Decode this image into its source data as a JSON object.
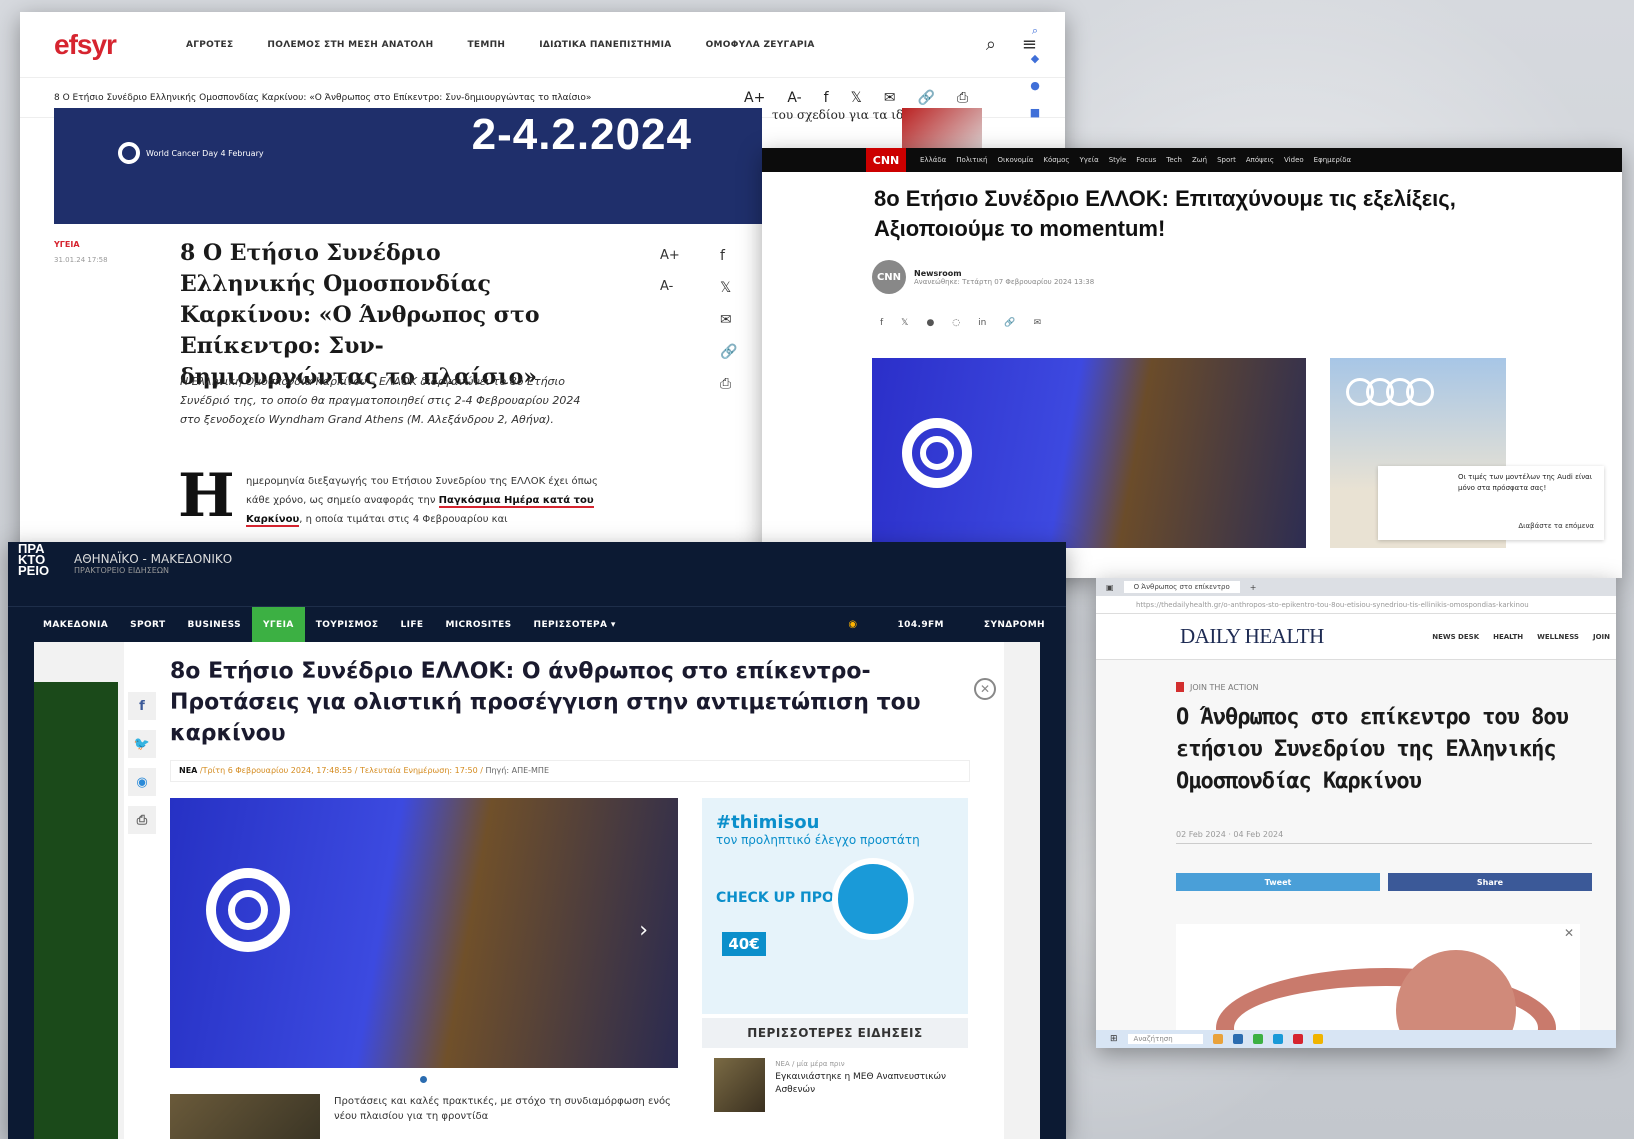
{
  "efsyr": {
    "logo": "efsyr",
    "nav": [
      "ΑΓΡΟΤΕΣ",
      "ΠΟΛΕΜΟΣ ΣΤΗ ΜΕΣΗ ΑΝΑΤΟΛΗ",
      "ΤΕΜΠΗ",
      "ΙΔΙΩΤΙΚΑ ΠΑΝΕΠΙΣΤΗΜΙΑ",
      "ΟΜΟΦΥΛΑ ΖΕΥΓΑΡΙΑ"
    ],
    "breadcrumb": "8 Ο Ετήσιο Συνέδριο Ελληνικής Ομοσπονδίας Καρκίνου: «Ο Άνθρωπος στο Επίκεντρο: Συν-δημιουργώντας το πλαίσιο»",
    "font_up": "A+",
    "font_down": "A-",
    "banner_date": "2-4.2.2024",
    "banner_badge": "World Cancer Day 4 February",
    "category": "ΥΓΕΙΑ",
    "category_date": "31.01.24 17:58",
    "title": "8 Ο Ετήσιο Συνέδριο Ελληνικής Ομοσπονδίας Καρκίνου: «Ο Άνθρωπος στο Επίκεντρο: Συν-δημιουργώντας το πλαίσιο»",
    "lead": "Η Ελληνική Ομοσπονδία Καρκίνου – ΕΛΛΟΚ διοργανώνει το 8ο Ετήσιο Συνέδριό της, το οποίο θα πραγματοποιηθεί στις 2-4 Φεβρουαρίου 2024 στο ξενοδοχείο Wyndham Grand Athens (Μ. Αλεξάνδρου 2, Αθήνα).",
    "drop_cap": "Η",
    "body_pre": "ημερομηνία διεξαγωγής του Ετήσιου Συνεδρίου της ΕΛΛΟΚ έχει όπως κάθε χρόνο, ως σημείο αναφοράς την ",
    "body_link": "Παγκόσμια Ημέρα κατά του Καρκίνου",
    "body_post": ", η οποία τιμάται στις 4 Φεβρουαρίου και",
    "sidebar_teaser": "του σχεδίου για τα ιδιωτικά ΑΕΙ"
  },
  "cnn": {
    "logo": "CNN",
    "nav": [
      "Ελλάδα",
      "Πολιτική",
      "Οικονομία",
      "Κόσμος",
      "Υγεία",
      "Style",
      "Focus",
      "Tech",
      "Ζωή",
      "Sport",
      "Απόψεις",
      "Video",
      "Εφημερίδα"
    ],
    "title": "8o Ετήσιο Συνέδριο ΕΛΛΟΚ: Επιταχύνουμε τις εξελίξεις, Αξιοποιούμε το momentum!",
    "avatar": "CNN",
    "author": "Newsroom",
    "date": "Ανανεώθηκε: Τετάρτη 07 Φεβρουαρίου 2024 13:38",
    "ad_text": "Οι τιμές των μοντέλων της Audi είναι μόνο στα πρόσφατα σας!",
    "ad_cta": "Διαβάστε τα επόμενα"
  },
  "apeb": {
    "brand": "ΠΡΑ ΚΤΟ ΡΕΙΟ",
    "brand_name": "ΑΘΗΝΑΪΚΟ - ΜΑΚΕΔΟΝΙΚΟ",
    "brand_sub": "ΠΡΑΚΤΟΡΕΙΟ ΕΙΔΗΣΕΩΝ",
    "menu": [
      "ΜΑΚΕΔΟΝΙΑ",
      "SPORT",
      "BUSINESS",
      "ΥΓΕΙΑ",
      "ΤΟΥΡΙΣΜΟΣ",
      "LIFE",
      "MICROSITES",
      "ΠΕΡΙΣΣΟΤΕΡΑ ▾"
    ],
    "radio": "104.9FM",
    "subscribe": "ΣΥΝΔΡΟΜΗ",
    "title": "8ο Ετήσιο Συνέδριο ΕΛΛΟΚ: Ο άνθρωπος στο επίκεντρο-Προτάσεις για ολιστική προσέγγιση στην αντιμετώπιση του καρκίνου",
    "meta_tag": "ΝΕΑ",
    "meta_date": "/Τρίτη 6 Φεβρουαρίου 2024, 17:48:55 / Τελευταία Ενημέρωση: 17:50 /",
    "meta_source": "Πηγή: ΑΠΕ-ΜΠΕ",
    "ad_hashtag": "#thimisou",
    "ad_sub": "τον προληπτικό έλεγχο προστάτη",
    "ad_check": "CHECK UP ΠΡΟΣΤΑΤΗ",
    "ad_price": "40€",
    "most_read": "ΠΕΡΙΣΣΟΤΕΡΕΣ ΕΙΔΗΣΕΙΣ",
    "mr_meta": "ΝΕΑ / μία μέρα πριν",
    "mr_title": "Εγκαινιάστηκε η ΜΕΘ Αναπνευστικών Ασθενών",
    "body_excerpt": "Προτάσεις και καλές πρακτικές, με στόχο τη συνδιαμόρφωση ενός νέου πλαισίου για τη φροντίδα"
  },
  "dh": {
    "tab": "Ο Άνθρωπος στο επίκεντρο",
    "url": "https://thedailyhealth.gr/o-anthropos-sto-epikentro-tou-8ou-etisiou-synedriou-tis-ellinikis-omospondias-karkinou",
    "logo": "DAILY HEALTH",
    "nav": [
      "NEWS DESK",
      "HEALTH",
      "WELLNESS",
      "JOIN"
    ],
    "kicker": "JOIN THE ACTION",
    "title": "Ο Άνθρωπος στο επίκεντρο του 8ου ετήσιου Συνεδρίου της Ελληνικής Ομοσπονδίας Καρκίνου",
    "dates": "02 Feb 2024 · 04 Feb 2024",
    "tweet": "Tweet",
    "share": "Share",
    "taskbar_search": "Αναζήτηση"
  }
}
